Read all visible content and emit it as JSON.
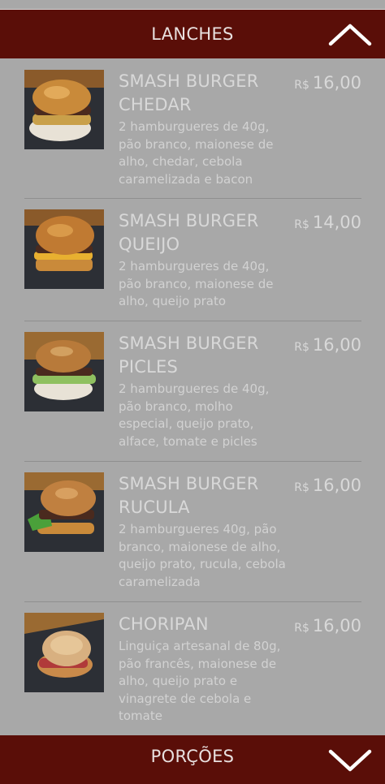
{
  "categories": {
    "top": {
      "label": "LANCHES",
      "icon": "chevron-up-icon"
    },
    "bottom": {
      "label": "PORÇÕES",
      "icon": "chevron-down-icon"
    }
  },
  "currency": "R$",
  "items": [
    {
      "name": "SMASH BURGER CHEDAR",
      "price": "16,00",
      "description": "2 hamburgueres de 40g, pão branco, maionese de alho, chedar, cebola caramelizada e bacon"
    },
    {
      "name": "SMASH BURGER QUEIJO",
      "price": "14,00",
      "description": "2 hamburgueres de 40g, pão branco, maionese de alho, queijo prato"
    },
    {
      "name": "SMASH BURGER PICLES",
      "price": "16,00",
      "description": "2 hamburgueres de 40g, pão branco, molho especial, queijo prato, alface, tomate e picles"
    },
    {
      "name": "SMASH BURGER RUCULA",
      "price": "16,00",
      "description": "2 hamburgueres 40g, pão branco, maionese de alho, queijo prato, rucula, cebola caramelizada"
    },
    {
      "name": "CHORIPAN",
      "price": "16,00",
      "description": "Linguiça artesanal de 80g, pão francês, maionese de alho, queijo prato e vinagrete de cebola e tomate"
    }
  ]
}
